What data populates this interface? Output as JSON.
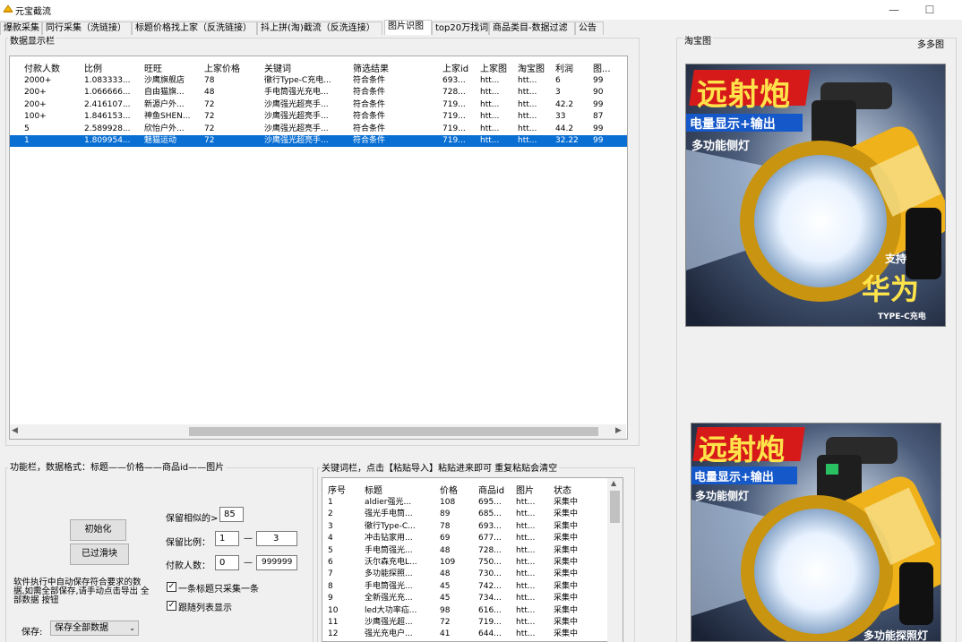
{
  "window": {
    "title": "元宝截流",
    "minimize": "—",
    "maximize": "☐"
  },
  "tabs": [
    {
      "label": "爆款采集"
    },
    {
      "label": "同行采集（洗链接）"
    },
    {
      "label": "标题价格找上家（反洗链接）"
    },
    {
      "label": "抖上拼(淘)截流（反洗连接）"
    },
    {
      "label": "图片识图"
    },
    {
      "label": "top20万找词"
    },
    {
      "label": "商品类目-数据过滤"
    },
    {
      "label": "公告"
    }
  ],
  "grid": {
    "group_title": "数据显示栏",
    "columns": [
      "付款人数",
      "比例",
      "旺旺",
      "上家价格",
      "关键词",
      "筛选结果",
      "上家id",
      "上家图",
      "淘宝图",
      "利润",
      "图..."
    ],
    "rows": [
      [
        "2000+",
        "1.083333...",
        "沙鹰旗舰店",
        "78",
        "徹行Type-C充电...",
        "符合条件",
        "693...",
        "htt...",
        "htt...",
        "6",
        "99"
      ],
      [
        "200+",
        "1.066666...",
        "自由猫旗...",
        "48",
        "手电筒强光充电...",
        "符合条件",
        "728...",
        "htt...",
        "htt...",
        "3",
        "90"
      ],
      [
        "200+",
        "2.416107...",
        "新源户外...",
        "72",
        "沙鹰强光超亮手...",
        "符合条件",
        "719...",
        "htt...",
        "htt...",
        "42.2",
        "99"
      ],
      [
        "100+",
        "1.846153...",
        "神鱼SHEN...",
        "72",
        "沙鹰强光超亮手...",
        "符合条件",
        "719...",
        "htt...",
        "htt...",
        "33",
        "87"
      ],
      [
        "5",
        "2.589928...",
        "欣怡户外...",
        "72",
        "沙鹰强光超亮手...",
        "符合条件",
        "719...",
        "htt...",
        "htt...",
        "44.2",
        "99"
      ],
      [
        "1",
        "1.809954...",
        "魅猫运动",
        "72",
        "沙鹰强光超亮手...",
        "符合条件",
        "719...",
        "htt...",
        "htt...",
        "32.22",
        "99"
      ]
    ],
    "selected_row": 5
  },
  "func": {
    "group_title": "功能栏，数据格式：标题——价格——商品id——图片",
    "init_button": "初始化",
    "filtered_button": "已过滑块",
    "similar_label": "保留相似的>",
    "similar_value": "85",
    "ratio_label": "保留比例：",
    "ratio_min": "1",
    "ratio_max": "3",
    "dash": "—",
    "pay_label": "付款人数：",
    "pay_min": "0",
    "pay_max": "999999",
    "note": "软件执行中自动保存符合要求的数据,如需全部保存,请手动点击导出 全部数据 按钮",
    "one_per_title": "一条标题只采集一条",
    "follow_list": "跟随列表显示",
    "save_label": "保存:",
    "save_select": "保存全部数据"
  },
  "keywords": {
    "group_title": "关键词栏，点击【粘贴导入】粘贴进来即可  重复粘贴会清空",
    "columns": [
      "序号",
      "标题",
      "价格",
      "商品id",
      "图片",
      "状态"
    ],
    "rows": [
      [
        "1",
        "aldier强光...",
        "108",
        "695...",
        "htt...",
        "采集中"
      ],
      [
        "2",
        "强光手电筒...",
        "89",
        "685...",
        "htt...",
        "采集中"
      ],
      [
        "3",
        "徹行Type-C...",
        "78",
        "693...",
        "htt...",
        "采集中"
      ],
      [
        "4",
        "冲击钻家用...",
        "69",
        "677...",
        "htt...",
        "采集中"
      ],
      [
        "5",
        "手电筒强光...",
        "48",
        "728...",
        "htt...",
        "采集中"
      ],
      [
        "6",
        "沃尔森充电L...",
        "109",
        "750...",
        "htt...",
        "采集中"
      ],
      [
        "7",
        "多功能探照...",
        "48",
        "730...",
        "htt...",
        "采集中"
      ],
      [
        "8",
        "手电筒强光...",
        "45",
        "742...",
        "htt...",
        "采集中"
      ],
      [
        "9",
        "全新强光充...",
        "45",
        "734...",
        "htt...",
        "采集中"
      ],
      [
        "10",
        "led大功率疝...",
        "98",
        "616...",
        "htt...",
        "采集中"
      ],
      [
        "11",
        "沙鹰强光超...",
        "72",
        "719...",
        "htt...",
        "采集中"
      ],
      [
        "12",
        "强光充电户...",
        "41",
        "644...",
        "htt...",
        "采集中"
      ]
    ]
  },
  "images": {
    "taobao_label": "淘宝图",
    "pdd_label": "多多图",
    "top": {
      "headline": "远射炮",
      "sub": "电量显示+输出",
      "feature": "多功能侧灯",
      "brand_support": "支持",
      "brand": "华为",
      "charge": "TYPE-C充电"
    },
    "bottom": {
      "headline": "远射炮",
      "sub": "电量显示+输出",
      "feature": "多功能侧灯",
      "bottom_text": "多功能探照灯"
    }
  }
}
